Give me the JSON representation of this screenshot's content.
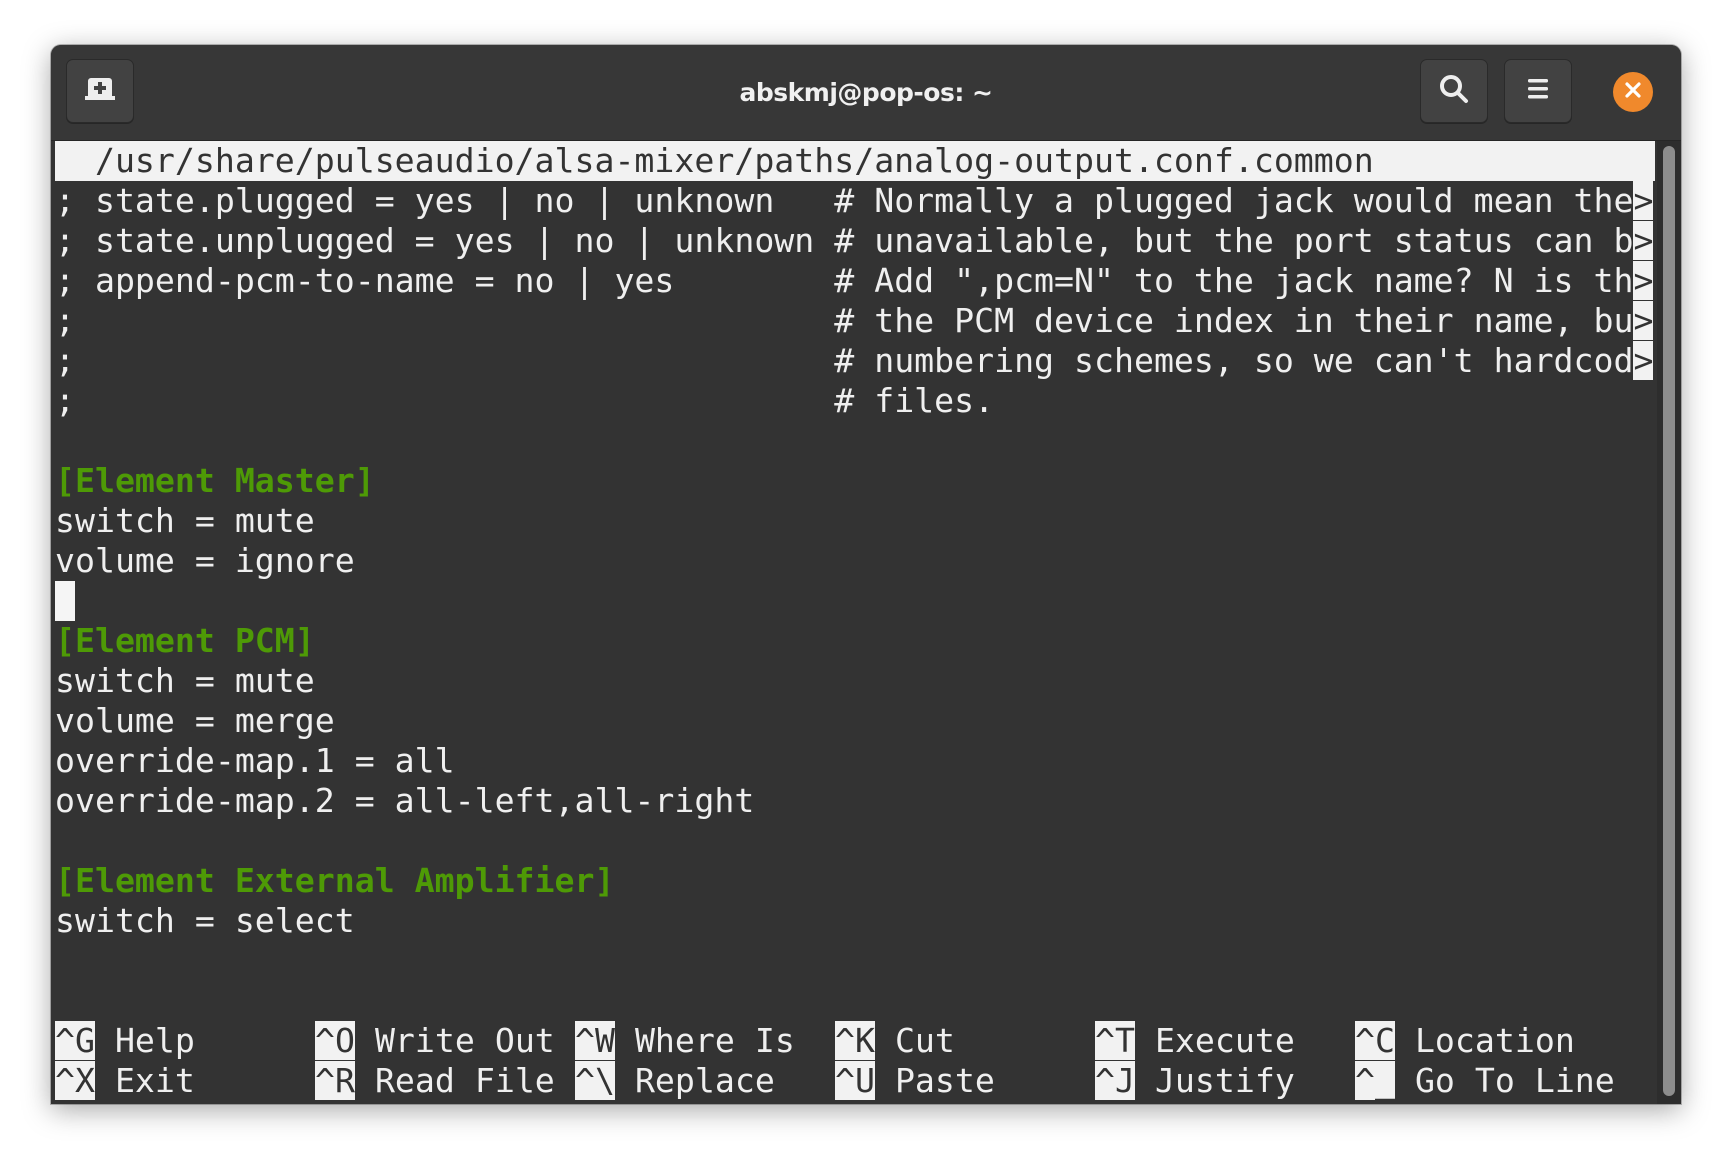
{
  "window": {
    "title": "abskmj@pop-os: ~",
    "buttons": {
      "new_tab": "new-tab-icon",
      "search": "search-icon",
      "menu": "hamburger-menu-icon",
      "close": "close-icon"
    },
    "colors": {
      "titlebar": "#373737",
      "terminal_bg": "#333333",
      "close_button": "#f0892c",
      "section_header": "#4e9a06"
    }
  },
  "nano": {
    "filename": "  /usr/share/pulseaudio/alsa-mixer/paths/analog-output.conf.common",
    "lines": [
      {
        "code": "; state.plugged = yes | no | unknown   ",
        "comment": "# Normally a plugged jack would mean the",
        "overflow": ">"
      },
      {
        "code": "; state.unplugged = yes | no | unknown ",
        "comment": "# unavailable, but the port status can b",
        "overflow": ">"
      },
      {
        "code": "; append-pcm-to-name = no | yes        ",
        "comment": "# Add \",pcm=N\" to the jack name? N is th",
        "overflow": ">"
      },
      {
        "code": ";                                      ",
        "comment": "# the PCM device index in their name, bu",
        "overflow": ">"
      },
      {
        "code": ";                                      ",
        "comment": "# numbering schemes, so we can't hardcod",
        "overflow": ">"
      },
      {
        "code": ";                                      ",
        "comment": "# files.",
        "overflow": ""
      }
    ],
    "sections": [
      {
        "header": "[Element Master]",
        "entries": [
          "switch = mute",
          "volume = ignore"
        ]
      },
      {
        "header": "[Element PCM]",
        "entries": [
          "switch = mute",
          "volume = merge",
          "override-map.1 = all",
          "override-map.2 = all-left,all-right"
        ]
      },
      {
        "header": "[Element External Amplifier]",
        "entries": [
          "switch = select"
        ]
      }
    ],
    "shortcuts": [
      [
        {
          "key": "^G",
          "label": "Help"
        },
        {
          "key": "^O",
          "label": "Write Out"
        },
        {
          "key": "^W",
          "label": "Where Is"
        },
        {
          "key": "^K",
          "label": "Cut"
        },
        {
          "key": "^T",
          "label": "Execute"
        },
        {
          "key": "^C",
          "label": "Location"
        }
      ],
      [
        {
          "key": "^X",
          "label": "Exit"
        },
        {
          "key": "^R",
          "label": "Read File"
        },
        {
          "key": "^\\",
          "label": "Replace"
        },
        {
          "key": "^U",
          "label": "Paste"
        },
        {
          "key": "^J",
          "label": "Justify"
        },
        {
          "key": "^_",
          "label": "Go To Line"
        }
      ]
    ]
  }
}
